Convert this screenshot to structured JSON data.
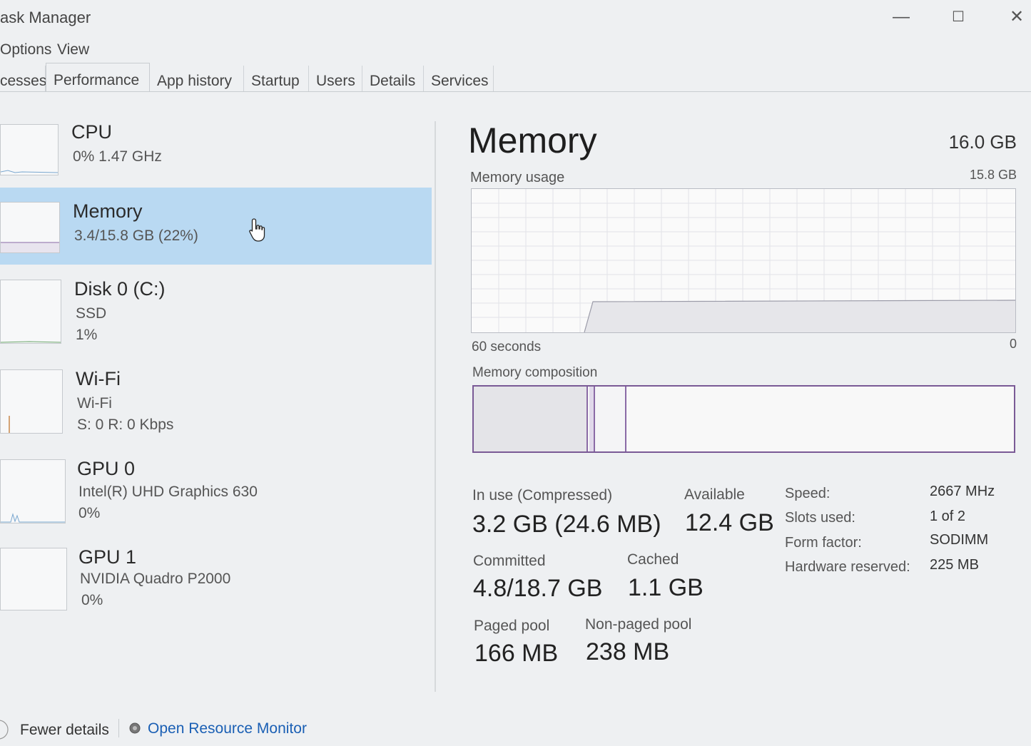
{
  "window": {
    "title": "ask Manager",
    "minimize": "—",
    "maximize": "☐",
    "close": "✕"
  },
  "menu": [
    "Options",
    "View"
  ],
  "tabs": [
    "cesses",
    "Performance",
    "App history",
    "Startup",
    "Users",
    "Details",
    "Services"
  ],
  "sidebar": [
    {
      "title": "CPU",
      "line1": "0%  1.47 GHz",
      "line2": ""
    },
    {
      "title": "Memory",
      "line1": "3.4/15.8 GB (22%)",
      "line2": ""
    },
    {
      "title": "Disk 0 (C:)",
      "line1": "SSD",
      "line2": "1%"
    },
    {
      "title": "Wi-Fi",
      "line1": "Wi-Fi",
      "line2": "S: 0  R: 0 Kbps"
    },
    {
      "title": "GPU 0",
      "line1": "Intel(R) UHD Graphics 630",
      "line2": "0%"
    },
    {
      "title": "GPU 1",
      "line1": "NVIDIA Quadro P2000",
      "line2": "0%"
    }
  ],
  "main": {
    "title": "Memory",
    "total": "16.0 GB",
    "usage_label": "Memory usage",
    "usage_max": "15.8 GB",
    "time_left": "60 seconds",
    "time_right": "0",
    "composition_label": "Memory composition",
    "stats": {
      "in_use_label": "In use (Compressed)",
      "in_use_value": "3.2 GB (24.6 MB)",
      "available_label": "Available",
      "available_value": "12.4 GB",
      "committed_label": "Committed",
      "committed_value": "4.8/18.7 GB",
      "cached_label": "Cached",
      "cached_value": "1.1 GB",
      "paged_label": "Paged pool",
      "paged_value": "166 MB",
      "nonpaged_label": "Non-paged pool",
      "nonpaged_value": "238 MB"
    },
    "specs": [
      {
        "key": "Speed:",
        "value": "2667 MHz"
      },
      {
        "key": "Slots used:",
        "value": "1 of 2"
      },
      {
        "key": "Form factor:",
        "value": "SODIMM"
      },
      {
        "key": "Hardware reserved:",
        "value": "225 MB"
      }
    ]
  },
  "footer": {
    "fewer": "Fewer details",
    "monitor": "Open Resource Monitor"
  },
  "colors": {
    "selected": "#b9d9f2",
    "memory_accent": "#7a5a96",
    "link": "#1a5fb4"
  }
}
